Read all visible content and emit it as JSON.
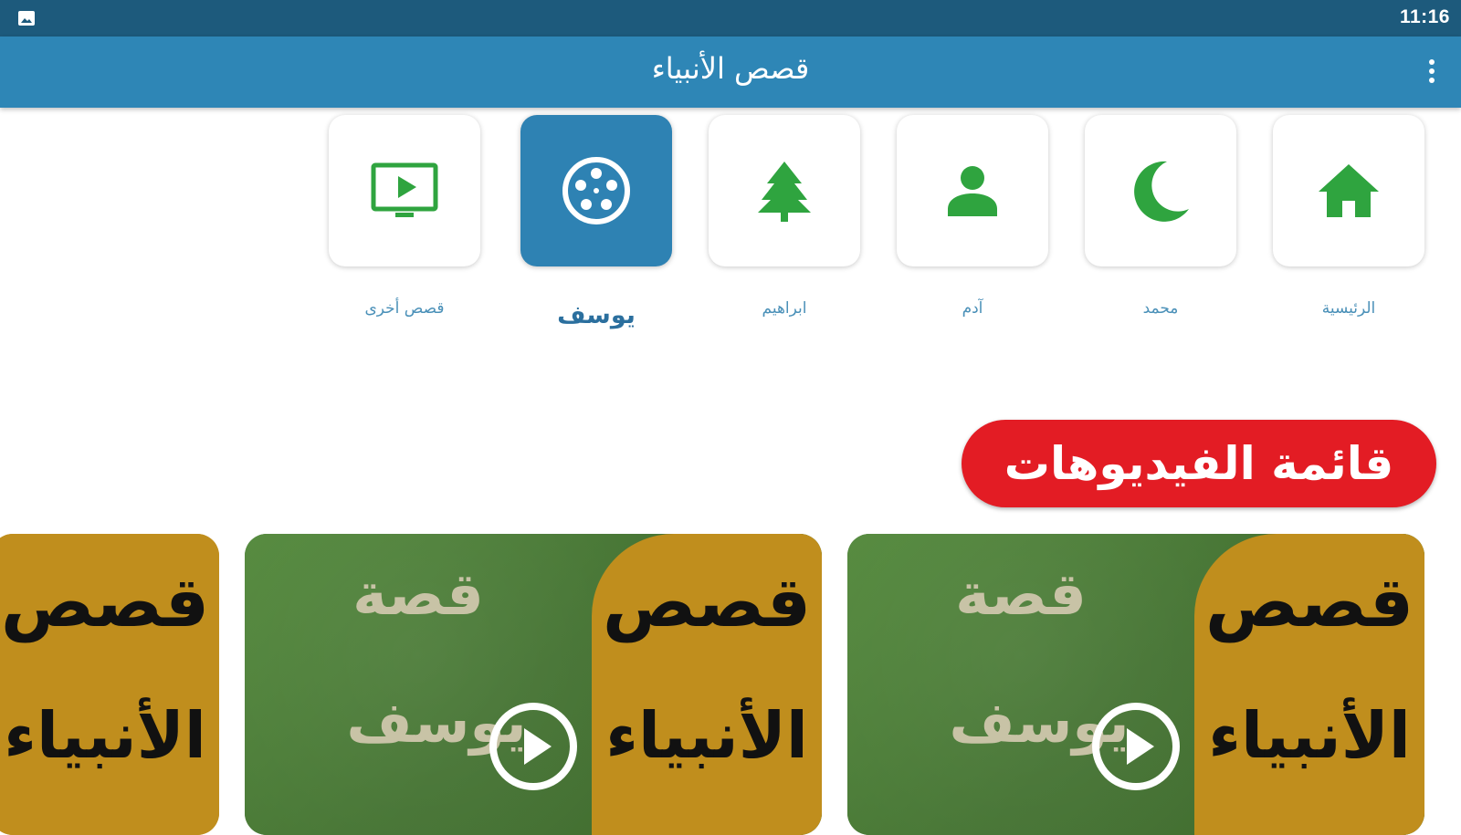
{
  "status_bar": {
    "time": "11:16"
  },
  "app_bar": {
    "title": "قصص الأنبياء"
  },
  "nav": {
    "items": [
      {
        "label": "الرئيسية",
        "icon": "home-icon",
        "active": false
      },
      {
        "label": "محمد",
        "icon": "crescent-moon-icon",
        "active": false
      },
      {
        "label": "آدم",
        "icon": "person-icon",
        "active": false
      },
      {
        "label": "ابراهيم",
        "icon": "tree-icon",
        "active": false
      },
      {
        "label": "يوسف",
        "icon": "film-reel-icon",
        "active": true
      },
      {
        "label": "قصص أخرى",
        "icon": "tv-play-icon",
        "active": false
      }
    ]
  },
  "section": {
    "title": "قائمة الفيديوهات"
  },
  "videos": [
    {
      "series_line1": "قصص",
      "series_line2": "الأنبياء",
      "story_word": "قصة",
      "prophet": "يوسف"
    },
    {
      "series_line1": "قصص",
      "series_line2": "الأنبياء",
      "story_word": "قصة",
      "prophet": "يوسف"
    },
    {
      "series_line1": "قصص",
      "series_line2": "الأنبياء"
    }
  ],
  "colors": {
    "status_bar": "#1d5a7c",
    "app_bar": "#2e86b6",
    "icon_green": "#2fa43f",
    "active_tile": "#2e82b3",
    "pill_red": "#e31c24",
    "thumb_gold": "#c08e1d",
    "thumb_green": "#4b7a38"
  }
}
